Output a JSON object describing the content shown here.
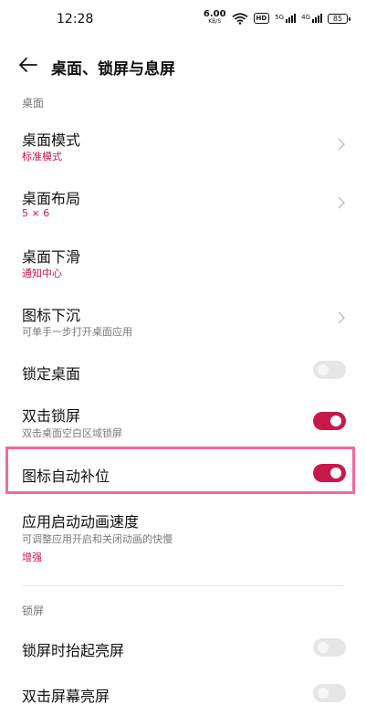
{
  "status": {
    "time": "12:28",
    "speed_value": "6.00",
    "speed_unit": "KB/S",
    "hd": "HD",
    "sim1": "5G",
    "sim2": "4G",
    "battery": "85"
  },
  "header": {
    "title": "桌面、锁屏与息屏"
  },
  "sections": {
    "desktop": "桌面",
    "lockscreen": "锁屏"
  },
  "rows": {
    "desktop_mode": {
      "title": "桌面模式",
      "sub": "标准模式"
    },
    "desktop_layout": {
      "title": "桌面布局",
      "sub": "5 × 6"
    },
    "desktop_swipe": {
      "title": "桌面下滑",
      "sub": "通知中心"
    },
    "icon_sink": {
      "title": "图标下沉",
      "sub": "可单手一步打开桌面应用"
    },
    "lock_desktop": {
      "title": "锁定桌面",
      "toggle": false
    },
    "double_tap_lock": {
      "title": "双击锁屏",
      "sub": "双击桌面空白区域锁屏",
      "toggle": true
    },
    "auto_fill_icons": {
      "title": "图标自动补位",
      "toggle": true
    },
    "launch_anim_speed": {
      "title": "应用启动动画速度",
      "sub": "可调整应用开启和关闭动画的快慢",
      "value": "增强"
    },
    "raise_to_wake": {
      "title": "锁屏时抬起亮屏",
      "toggle": false
    },
    "double_tap_wake": {
      "title": "双击屏幕亮屏",
      "toggle": false
    }
  },
  "colors": {
    "accent": "#c8194a",
    "highlight": "#f06a9a"
  }
}
